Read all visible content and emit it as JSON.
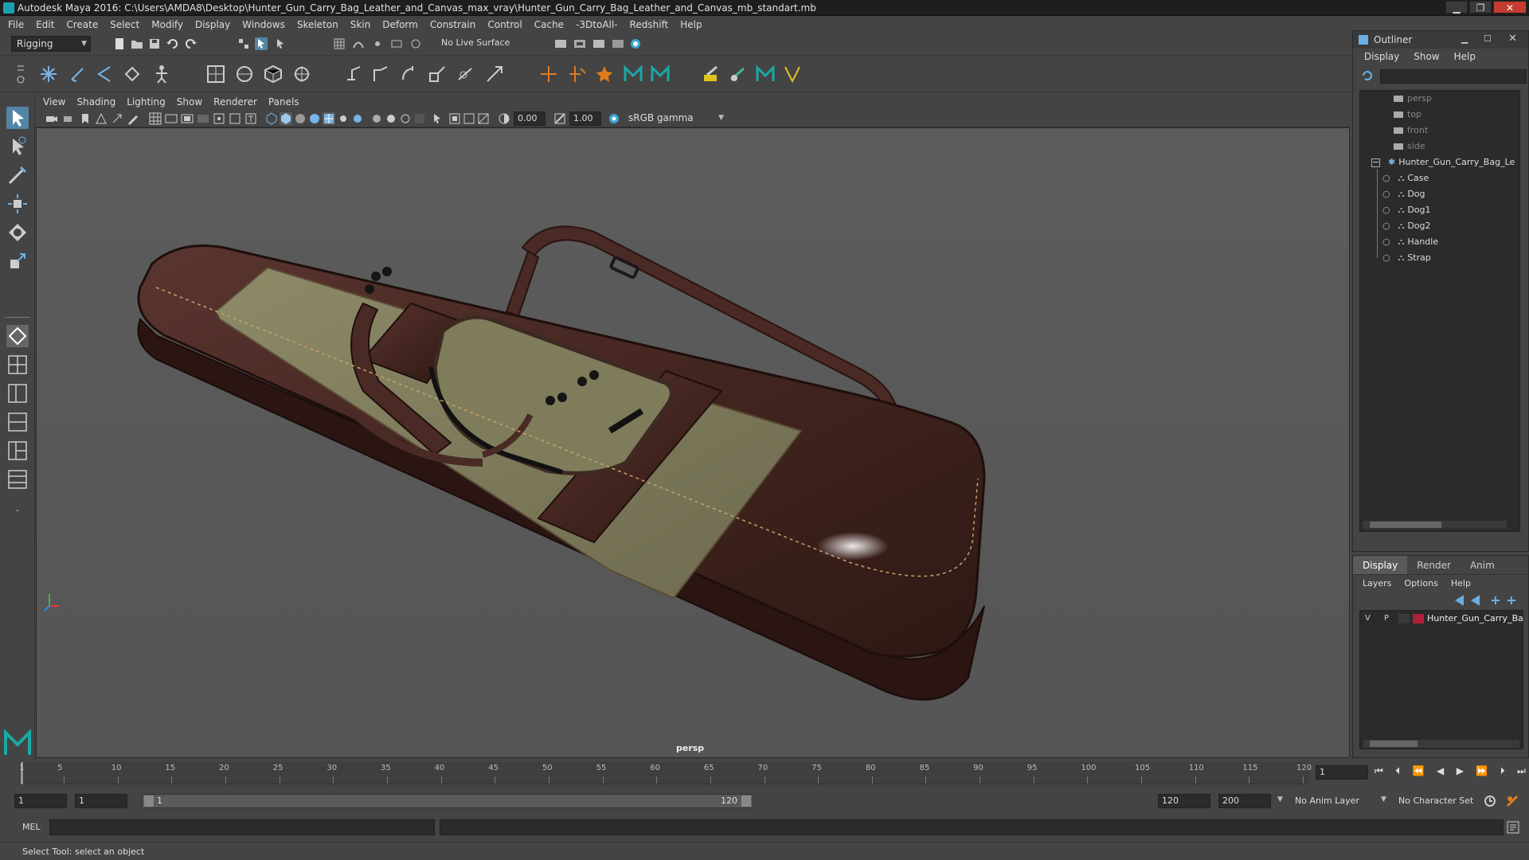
{
  "window": {
    "title": "Autodesk Maya 2016: C:\\Users\\AMDA8\\Desktop\\Hunter_Gun_Carry_Bag_Leather_and_Canvas_max_vray\\Hunter_Gun_Carry_Bag_Leather_and_Canvas_mb_standart.mb",
    "minimize": "▁",
    "maximize": "❐",
    "close": "✕"
  },
  "menus": [
    "File",
    "Edit",
    "Create",
    "Select",
    "Modify",
    "Display",
    "Windows",
    "Skeleton",
    "Skin",
    "Deform",
    "Constrain",
    "Control",
    "Cache",
    "-3DtoAll-",
    "Redshift",
    "Help"
  ],
  "statusline": {
    "menuset": "Rigging",
    "live_surface": "No Live Surface"
  },
  "viewport": {
    "menus": [
      "View",
      "Shading",
      "Lighting",
      "Show",
      "Renderer",
      "Panels"
    ],
    "exposure": "0.00",
    "gamma": "1.00",
    "color_space": "sRGB gamma",
    "camera_label": "persp"
  },
  "outliner": {
    "title": "Outliner",
    "menus": [
      "Display",
      "Show",
      "Help"
    ],
    "cameras": [
      "persp",
      "top",
      "front",
      "side"
    ],
    "group": "Hunter_Gun_Carry_Bag_Le",
    "children": [
      "Case",
      "Dog",
      "Dog1",
      "Dog2",
      "Handle",
      "Strap"
    ]
  },
  "layer_editor": {
    "tabs": [
      "Display",
      "Render",
      "Anim"
    ],
    "active_tab": "Display",
    "menus": [
      "Layers",
      "Options",
      "Help"
    ],
    "layer": {
      "v": "V",
      "p": "P",
      "name": "Hunter_Gun_Carry_Ba",
      "color": "#b0203a"
    }
  },
  "timeline": {
    "ticks": [
      "1",
      "5",
      "10",
      "15",
      "20",
      "25",
      "30",
      "35",
      "40",
      "45",
      "50",
      "55",
      "60",
      "65",
      "70",
      "75",
      "80",
      "85",
      "90",
      "95",
      "100",
      "105",
      "110",
      "115",
      "120"
    ],
    "current_frame": "1"
  },
  "range": {
    "start": "1",
    "playback_start": "1",
    "bar_start": "1",
    "bar_end": "120",
    "playback_end": "120",
    "end": "200",
    "anim_layer": "No Anim Layer",
    "character_set": "No Character Set"
  },
  "command": {
    "label": "MEL"
  },
  "help_line": "Select Tool: select an object"
}
